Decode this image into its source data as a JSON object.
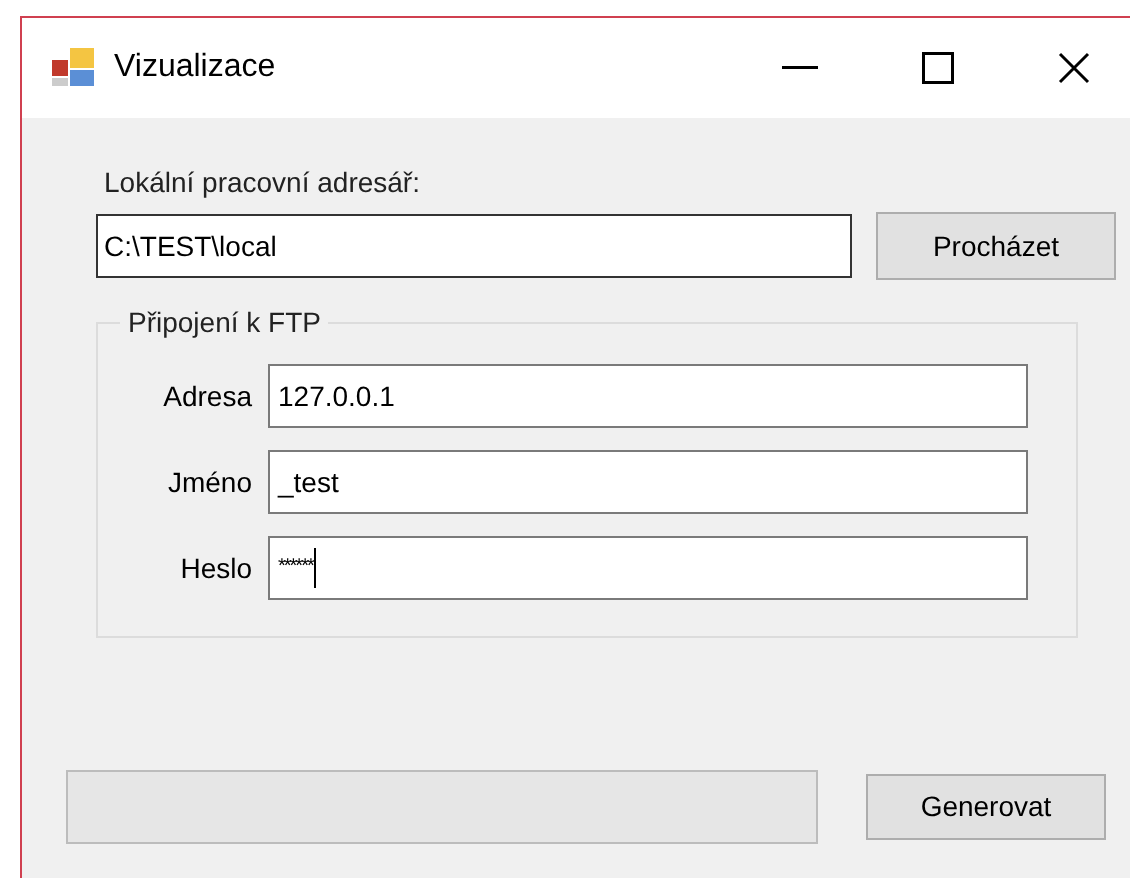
{
  "window": {
    "title": "Vizualizace"
  },
  "directory": {
    "label": "Lokální pracovní adresář:",
    "value": "C:\\TEST\\local",
    "browse_button": "Procházet"
  },
  "ftp": {
    "title": "Připojení k FTP",
    "fields": [
      {
        "label": "Adresa",
        "value": "127.0.0.1",
        "kind": "text"
      },
      {
        "label": "Jméno",
        "value": "_test",
        "kind": "text"
      },
      {
        "label": "Heslo",
        "value": "******",
        "kind": "password"
      }
    ]
  },
  "progress": {
    "level": 0
  },
  "generate_button": "Generovat"
}
